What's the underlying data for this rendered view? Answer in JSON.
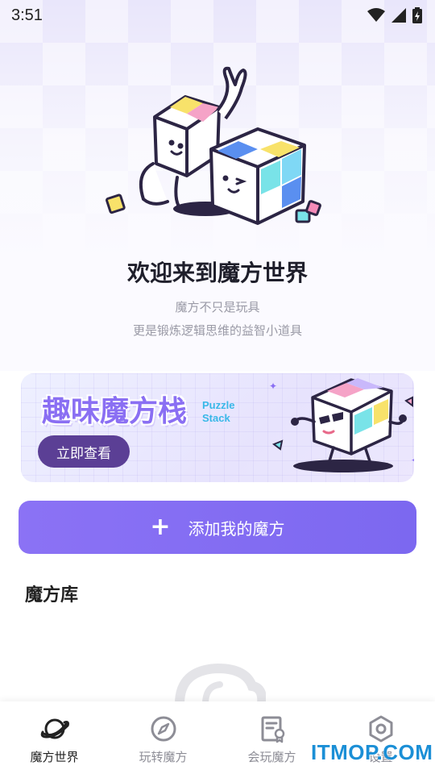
{
  "status_bar": {
    "time": "3:51"
  },
  "welcome": {
    "title": "欢迎来到魔方世界",
    "subtitle_line1": "魔方不只是玩具",
    "subtitle_line2": "更是锻炼逻辑思维的益智小道具"
  },
  "banner": {
    "title": "趣味魔方栈",
    "english_line1": "Puzzle",
    "english_line2": "Stack",
    "button_label": "立即查看"
  },
  "add_button": {
    "icon": "plus-icon",
    "label": "添加我的魔方"
  },
  "library": {
    "title": "魔方库"
  },
  "tabs": [
    {
      "label": "魔方世界",
      "icon": "planet-icon",
      "active": true
    },
    {
      "label": "玩转魔方",
      "icon": "compass-icon",
      "active": false
    },
    {
      "label": "会玩魔方",
      "icon": "certificate-icon",
      "active": false
    },
    {
      "label": "设置",
      "icon": "settings-icon",
      "active": false
    }
  ],
  "watermark": "ITMOP.COM",
  "colors": {
    "accent": "#8b72f5",
    "banner_button": "#5b3f95",
    "banner_title": "#8a6ff3",
    "watermark": "#1b8fd6"
  }
}
